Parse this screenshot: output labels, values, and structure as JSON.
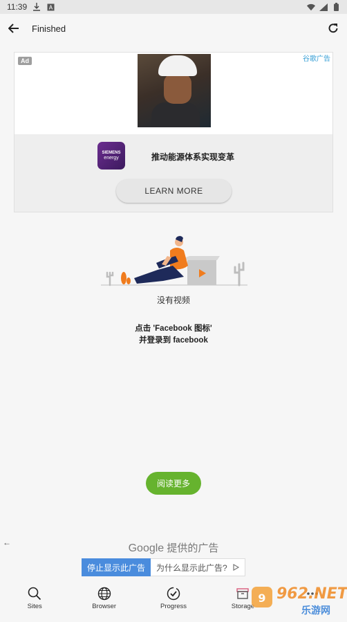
{
  "status_bar": {
    "time": "11:39",
    "icons": [
      "download-icon",
      "a-box-icon",
      "wifi-icon",
      "signal-icon",
      "battery-icon"
    ]
  },
  "app_bar": {
    "title": "Finished",
    "back_icon": "back-arrow-icon",
    "refresh_icon": "refresh-icon"
  },
  "ad_banner": {
    "badge": "Ad",
    "corner_label": "谷歌广告",
    "logo_text_line1": "SIEMENS",
    "logo_text_line2": "energy",
    "headline": "推动能源体系实现变革",
    "cta_label": "LEARN MORE"
  },
  "empty_state": {
    "label": "没有视频",
    "hint_line1": "点击 'Facebook 图标'",
    "hint_line2": "并登录到 facebook"
  },
  "read_more": {
    "label": "阅读更多"
  },
  "google_ads": {
    "brand": "Google",
    "provided_text": "提供的广告",
    "stop_label": "停止显示此广告",
    "why_label": "为什么显示此广告?"
  },
  "bottom_nav": {
    "items": [
      {
        "label": "Sites",
        "icon": "search-icon"
      },
      {
        "label": "Browser",
        "icon": "globe-icon"
      },
      {
        "label": "Progress",
        "icon": "check-circle-icon"
      },
      {
        "label": "Storage",
        "icon": "archive-icon"
      },
      {
        "label": "",
        "icon": "more-icon"
      }
    ]
  },
  "watermark": {
    "line1": "962.NET",
    "line2": "乐游网"
  },
  "colors": {
    "background": "#f6f6f6",
    "accent_green": "#66b32e",
    "stop_blue": "#4a8cdd",
    "illustration_orange": "#f07c1e",
    "illustration_navy": "#1e2a5a"
  }
}
